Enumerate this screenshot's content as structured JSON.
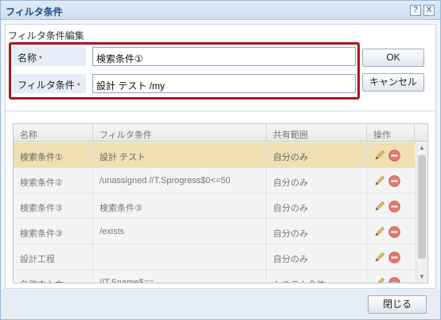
{
  "window": {
    "title": "フィルタ条件",
    "help_label": "?",
    "close_label": "X"
  },
  "edit": {
    "section_title": "フィルタ条件編集",
    "name_label": "名称",
    "filter_label": "フィルタ条件",
    "required_mark": "*",
    "name_value": "検索条件①",
    "filter_value": "設計 テスト /my",
    "ok_label": "OK",
    "cancel_label": "キャンセル"
  },
  "grid": {
    "headers": [
      "名称",
      "フィルタ条件",
      "共有範囲",
      "操作"
    ],
    "rows": [
      {
        "name": "検索条件①",
        "filter": "設計 テスト",
        "scope": "自分のみ",
        "selected": true
      },
      {
        "name": "検索条件②",
        "filter": "/unassigned //T.Sprogress$0<=50",
        "scope": "自分のみ",
        "selected": false
      },
      {
        "name": "検索条件③",
        "filter": "検索条件③",
        "scope": "自分のみ",
        "selected": false
      },
      {
        "name": "検索条件③",
        "filter": "/exists",
        "scope": "自分のみ",
        "selected": false
      },
      {
        "name": "設計工程",
        "filter": "",
        "scope": "自分のみ",
        "selected": false
      },
      {
        "name": "名称未入力",
        "filter": "//T.Sname$==",
        "scope": "システム全体",
        "selected": false
      }
    ],
    "action_icons": [
      "pencil-icon",
      "remove-icon"
    ]
  },
  "footer": {
    "close_label": "閉じる"
  },
  "colors": {
    "accent_border": "#b0141e",
    "selected_row": "#efdfb2",
    "required": "#dd0000"
  }
}
